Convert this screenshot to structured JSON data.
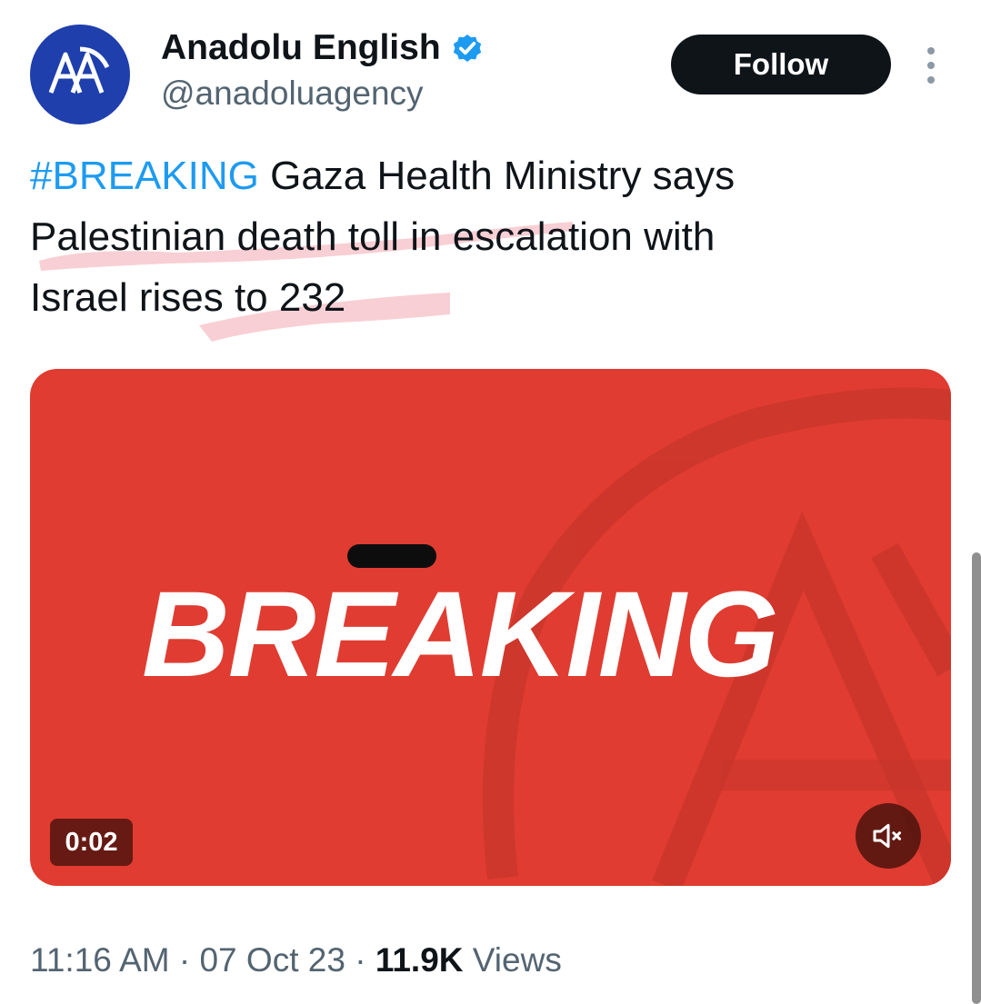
{
  "tweet": {
    "author": {
      "display_name": "Anadolu English",
      "handle": "@anadoluagency",
      "avatar_logo": "AA",
      "verified": true
    },
    "follow_label": "Follow",
    "text": {
      "hashtag": "#BREAKING",
      "line1": " Gaza Health Ministry says",
      "line2": "Palestinian death toll in escalation with",
      "line3": "Israel rises to 232"
    },
    "media": {
      "headline": "BREAKING",
      "duration": "0:02",
      "mute_icon": "speaker-muted-icon"
    },
    "meta": {
      "time": "11:16 AM",
      "date": "07 Oct 23",
      "separator": "·",
      "views_count": "11.9K",
      "views_label": "Views"
    }
  },
  "colors": {
    "brand_red": "#e03c31",
    "hashtag_blue": "#1d9bf0",
    "avatar_blue": "#1f3fad",
    "highlight_pink": "#f7c7cc"
  }
}
